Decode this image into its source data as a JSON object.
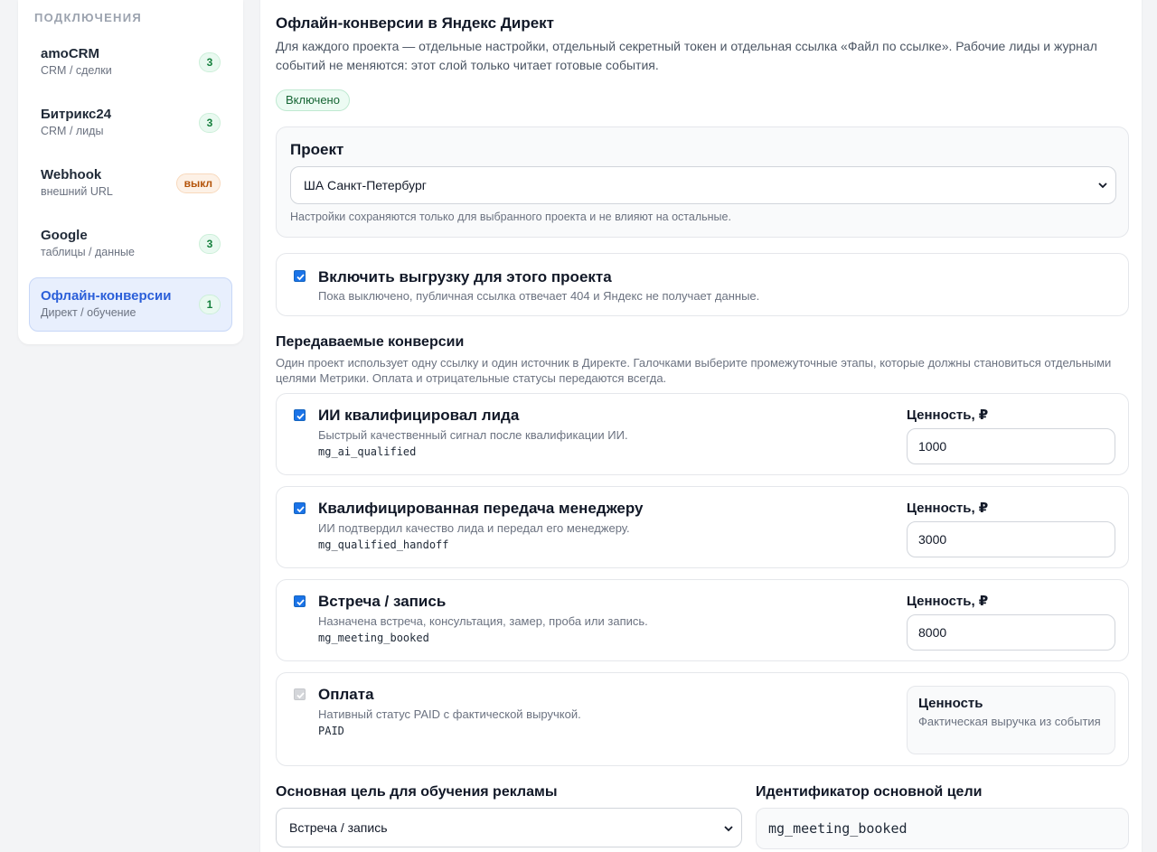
{
  "sidebar": {
    "heading": "ПОДКЛЮЧЕНИЯ",
    "items": [
      {
        "title": "amoCRM",
        "sub": "CRM / сделки",
        "badge": "3"
      },
      {
        "title": "Битрикс24",
        "sub": "CRM / лиды",
        "badge": "3"
      },
      {
        "title": "Webhook",
        "sub": "внешний URL",
        "badge": "выкл"
      },
      {
        "title": "Google",
        "sub": "таблицы / данные",
        "badge": "3"
      },
      {
        "title": "Офлайн-конверсии",
        "sub": "Директ / обучение",
        "badge": "1"
      }
    ]
  },
  "main": {
    "title": "Офлайн-конверсии в Яндекс Директ",
    "description": "Для каждого проекта — отдельные настройки, отдельный секретный токен и отдельная ссылка «Файл по ссылке». Рабочие лиды и журнал событий не меняются: этот слой только читает готовые события.",
    "status": "Включено",
    "project": {
      "label": "Проект",
      "selected": "ША Санкт-Петербург",
      "hint": "Настройки сохраняются только для выбранного проекта и не влияют на остальные."
    },
    "export": {
      "label": "Включить выгрузку для этого проекта",
      "hint": "Пока выключено, публичная ссылка отвечает 404 и Яндекс не получает данные."
    },
    "conversions": {
      "title": "Передаваемые конверсии",
      "description": "Один проект использует одну ссылку и один источник в Директе. Галочками выберите промежуточные этапы, которые должны становиться отдельными целями Метрики. Оплата и отрицательные статусы передаются всегда.",
      "items": [
        {
          "title": "ИИ квалифицировал лида",
          "desc": "Быстрый качественный сигнал после квалификации ИИ.",
          "code": "mg_ai_qualified",
          "value_label": "Ценность, ₽",
          "value": "1000"
        },
        {
          "title": "Квалифицированная передача менеджеру",
          "desc": "ИИ подтвердил качество лида и передал его менеджеру.",
          "code": "mg_qualified_handoff",
          "value_label": "Ценность, ₽",
          "value": "3000"
        },
        {
          "title": "Встреча / запись",
          "desc": "Назначена встреча, консультация, замер, проба или запись.",
          "code": "mg_meeting_booked",
          "value_label": "Ценность, ₽",
          "value": "8000"
        },
        {
          "title": "Оплата",
          "desc": "Нативный статус PAID с фактической выручкой.",
          "code": "PAID",
          "value_label": "Ценность",
          "value_note": "Фактическая выручка из события"
        }
      ]
    },
    "goal": {
      "label": "Основная цель для обучения рекламы",
      "selected": "Встреча / запись",
      "id_label": "Идентификатор основной цели",
      "id_value": "mg_meeting_booked"
    }
  },
  "colors": {
    "accent": "#1a73e8",
    "active_bg": "#e8effd",
    "active_text": "#2b5fd9",
    "badge_green": "#15803d",
    "badge_orange": "#b45309"
  }
}
